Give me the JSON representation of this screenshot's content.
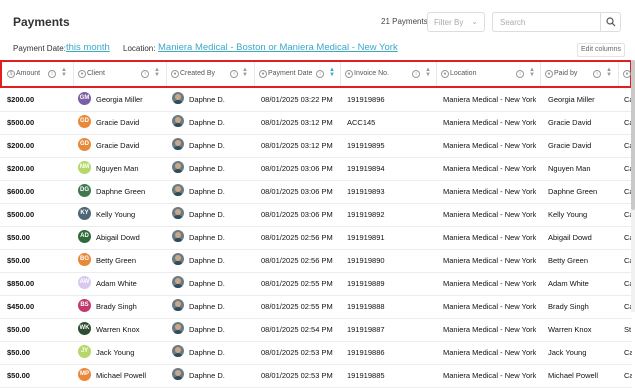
{
  "header": {
    "title": "Payments",
    "count": "21 Payments",
    "filter_label": "Filter By",
    "search_placeholder": "Search"
  },
  "filters": {
    "payment_date_label": "Payment Date:",
    "payment_date_value": "this month",
    "location_label": "Location:",
    "location_value": "Maniera Medical - Boston or Maniera Medical - New York",
    "edit_columns": "Edit columns"
  },
  "columns": [
    "Amount",
    "Client",
    "Created By",
    "Payment Date",
    "Invoice No.",
    "Location",
    "Paid by"
  ],
  "colors": {
    "accent": "#3aa9c6",
    "highlight": "#e02020"
  },
  "rows": [
    {
      "amount": "$200.00",
      "initials": "GM",
      "avatar_color": "#7b5ea7",
      "client": "Georgia Miller",
      "created_by": "Daphne D.",
      "date": "08/01/2025 03:22 PM",
      "invoice": "191919896",
      "location": "Maniera Medical - New York",
      "paid_by": "Georgia Miller",
      "extra": "Ca"
    },
    {
      "amount": "$500.00",
      "initials": "GD",
      "avatar_color": "#e8893a",
      "client": "Gracie David",
      "created_by": "Daphne D.",
      "date": "08/01/2025 03:12 PM",
      "invoice": "ACC145",
      "location": "Maniera Medical - New York",
      "paid_by": "Gracie David",
      "extra": "Ca"
    },
    {
      "amount": "$200.00",
      "initials": "GD",
      "avatar_color": "#e8893a",
      "client": "Gracie David",
      "created_by": "Daphne D.",
      "date": "08/01/2025 03:12 PM",
      "invoice": "191919895",
      "location": "Maniera Medical - New York",
      "paid_by": "Gracie David",
      "extra": "Ca"
    },
    {
      "amount": "$200.00",
      "initials": "NM",
      "avatar_color": "#b4d86a",
      "client": "Nguyen Man",
      "created_by": "Daphne D.",
      "date": "08/01/2025 03:06 PM",
      "invoice": "191919894",
      "location": "Maniera Medical - New York",
      "paid_by": "Nguyen Man",
      "extra": "Ca"
    },
    {
      "amount": "$600.00",
      "initials": "DG",
      "avatar_color": "#3e7a4e",
      "client": "Daphne Green",
      "created_by": "Daphne D.",
      "date": "08/01/2025 03:06 PM",
      "invoice": "191919893",
      "location": "Maniera Medical - New York",
      "paid_by": "Daphne Green",
      "extra": "Ca"
    },
    {
      "amount": "$500.00",
      "initials": "KY",
      "avatar_color": "#4e6675",
      "client": "Kelly Young",
      "created_by": "Daphne D.",
      "date": "08/01/2025 03:06 PM",
      "invoice": "191919892",
      "location": "Maniera Medical - New York",
      "paid_by": "Kelly Young",
      "extra": "Ca"
    },
    {
      "amount": "$50.00",
      "initials": "AD",
      "avatar_color": "#2f6b3a",
      "client": "Abigail Dowd",
      "created_by": "Daphne D.",
      "date": "08/01/2025 02:56 PM",
      "invoice": "191919891",
      "location": "Maniera Medical - New York",
      "paid_by": "Abigail Dowd",
      "extra": "Ca"
    },
    {
      "amount": "$50.00",
      "initials": "BG",
      "avatar_color": "#e8893a",
      "client": "Betty Green",
      "created_by": "Daphne D.",
      "date": "08/01/2025 02:56 PM",
      "invoice": "191919890",
      "location": "Maniera Medical - New York",
      "paid_by": "Betty Green",
      "extra": "Ca"
    },
    {
      "amount": "$850.00",
      "initials": "AW",
      "avatar_color": "#d9c9ef",
      "client": "Adam White",
      "created_by": "Daphne D.",
      "date": "08/01/2025 02:55 PM",
      "invoice": "191919889",
      "location": "Maniera Medical - New York",
      "paid_by": "Adam White",
      "extra": "Ca"
    },
    {
      "amount": "$450.00",
      "initials": "BS",
      "avatar_color": "#c23a6d",
      "client": "Brady Singh",
      "created_by": "Daphne D.",
      "date": "08/01/2025 02:55 PM",
      "invoice": "191919888",
      "location": "Maniera Medical - New York",
      "paid_by": "Brady Singh",
      "extra": "Ca"
    },
    {
      "amount": "$50.00",
      "initials": "WK",
      "avatar_color": "#2f4d2f",
      "client": "Warren Knox",
      "created_by": "Daphne D.",
      "date": "08/01/2025 02:54 PM",
      "invoice": "191919887",
      "location": "Maniera Medical - New York",
      "paid_by": "Warren Knox",
      "extra": "St"
    },
    {
      "amount": "$50.00",
      "initials": "JY",
      "avatar_color": "#b4d86a",
      "client": "Jack Young",
      "created_by": "Daphne D.",
      "date": "08/01/2025 02:53 PM",
      "invoice": "191919886",
      "location": "Maniera Medical - New York",
      "paid_by": "Jack Young",
      "extra": "Ca"
    },
    {
      "amount": "$50.00",
      "initials": "MP",
      "avatar_color": "#e8893a",
      "client": "Michael Powell",
      "created_by": "Daphne D.",
      "date": "08/01/2025 02:53 PM",
      "invoice": "191919885",
      "location": "Maniera Medical - New York",
      "paid_by": "Michael Powell",
      "extra": "Ca"
    }
  ]
}
